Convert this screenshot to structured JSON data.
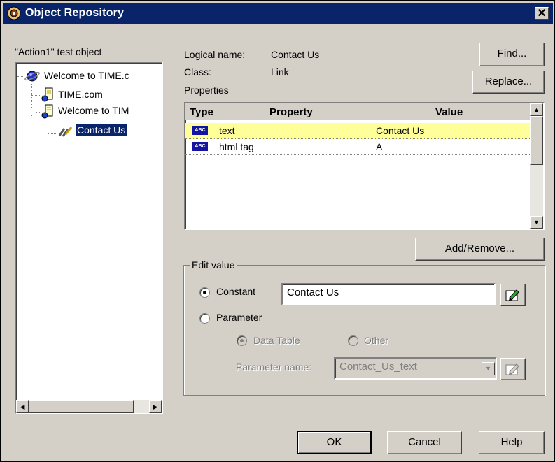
{
  "window": {
    "title": "Object Repository",
    "close_label": "✕"
  },
  "tree": {
    "caption": "\"Action1\" test object",
    "items": [
      {
        "label": "Welcome to TIME.c",
        "icon": "browser-icon"
      },
      {
        "label": "TIME.com",
        "icon": "page-icon"
      },
      {
        "label": "Welcome to TIM",
        "icon": "page-icon",
        "expander": "−"
      },
      {
        "label": "Contact Us",
        "icon": "link-icon",
        "selected": true
      }
    ]
  },
  "details": {
    "logical_name_label": "Logical name:",
    "logical_name_value": "Contact Us",
    "class_label": "Class:",
    "class_value": "Link",
    "properties_label": "Properties"
  },
  "buttons": {
    "find": "Find...",
    "replace": "Replace...",
    "add_remove": "Add/Remove...",
    "ok": "OK",
    "cancel": "Cancel",
    "help": "Help"
  },
  "grid": {
    "columns": [
      "Type",
      "Property",
      "Value"
    ],
    "type_badge": "ABC",
    "rows": [
      {
        "property": "text",
        "value": "Contact Us",
        "highlight": true
      },
      {
        "property": "html tag",
        "value": "A",
        "highlight": false
      }
    ]
  },
  "edit_value": {
    "group_label": "Edit value",
    "constant_label": "Constant",
    "constant_value": "Contact Us",
    "parameter_label": "Parameter",
    "data_table_label": "Data Table",
    "other_label": "Other",
    "param_name_label": "Parameter name:",
    "param_name_value": "Contact_Us_text",
    "selected": "constant"
  },
  "colors": {
    "titlebar": "#0a246a",
    "highlight_row": "#ffff99",
    "selection": "#0a246a"
  }
}
